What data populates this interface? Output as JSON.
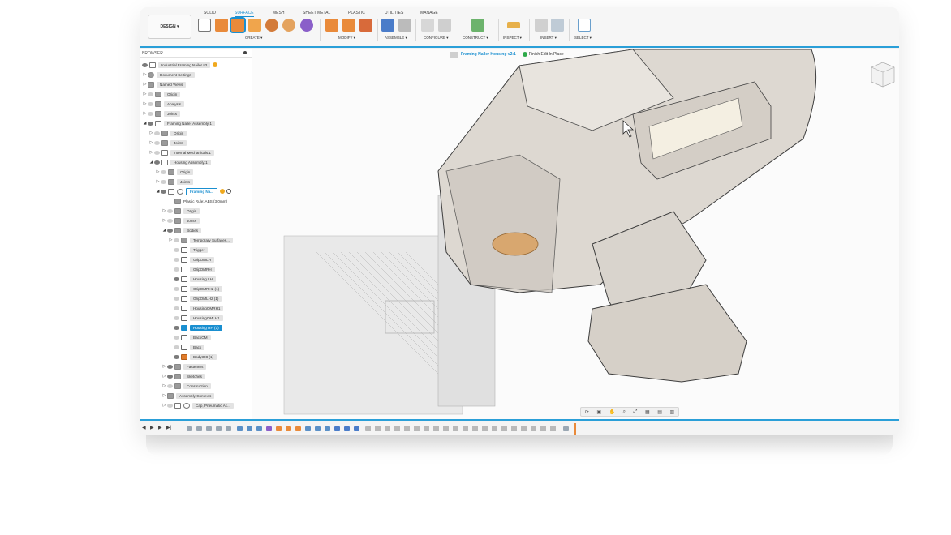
{
  "toolbar": {
    "workspace_button": "DESIGN ▾",
    "tabs": [
      "SOLID",
      "SURFACE",
      "MESH",
      "SHEET METAL",
      "PLASTIC",
      "UTILITIES",
      "MANAGE"
    ],
    "active_tab": "SURFACE",
    "groups": [
      "CREATE ▾",
      "MODIFY ▾",
      "ASSEMBLE ▾",
      "CONFIGURE ▾",
      "CONSTRUCT ▾",
      "INSPECT ▾",
      "INSERT ▾",
      "SELECT ▾"
    ]
  },
  "browser": {
    "title": "BROWSER",
    "items": [
      {
        "label": "Industrial Framing Nailer v3"
      },
      {
        "label": "Document Settings"
      },
      {
        "label": "Named Views"
      },
      {
        "label": "Origin"
      },
      {
        "label": "Analysis"
      },
      {
        "label": "Joints"
      },
      {
        "label": "Framing Nailer Assembly:1"
      },
      {
        "label": "Origin"
      },
      {
        "label": "Joints"
      },
      {
        "label": "Internal Mechanicals:1"
      },
      {
        "label": "Housing Assembly:1"
      },
      {
        "label": "Origin"
      },
      {
        "label": "Joints"
      },
      {
        "label": "Framing Na..."
      },
      {
        "label": "Plastic Rule: ABS (3.0mm)"
      },
      {
        "label": "Origin"
      },
      {
        "label": "Joints"
      },
      {
        "label": "Bodies"
      },
      {
        "label": "Temporary Surfaces..."
      },
      {
        "label": "Trigger"
      },
      {
        "label": "GripOMLH"
      },
      {
        "label": "GripOMRH"
      },
      {
        "label": "Housing LH"
      },
      {
        "label": "GripOMRH2 (1)"
      },
      {
        "label": "GripOMLH2 (1)"
      },
      {
        "label": "HousingOMRH1"
      },
      {
        "label": "HousingOMLH1"
      },
      {
        "label": "Housing RH (1)"
      },
      {
        "label": "BackOM"
      },
      {
        "label": "Back"
      },
      {
        "label": "Body308 (1)"
      },
      {
        "label": "Fasteners"
      },
      {
        "label": "Sketches"
      },
      {
        "label": "Construction"
      },
      {
        "label": "Assembly Contexts"
      },
      {
        "label": "Cap, Pneumatic Ac..."
      }
    ]
  },
  "canvas": {
    "edit_context": "Framing Nailer Housing v2:1",
    "finish_label": "Finish Edit In Place"
  },
  "colors": {
    "accent": "#1a8fd0",
    "warning": "#f0a91e",
    "success": "#2eaa4a"
  }
}
